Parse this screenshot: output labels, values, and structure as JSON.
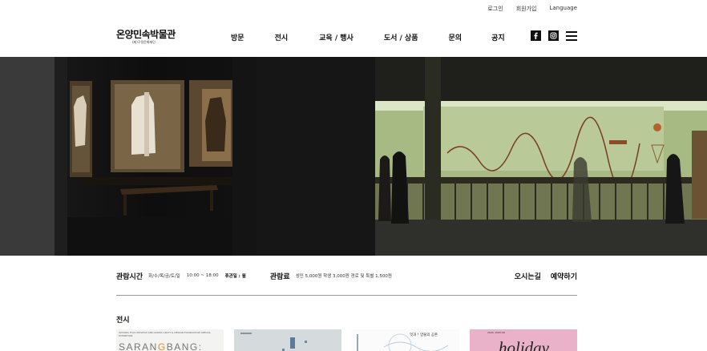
{
  "utility": {
    "login": "로그인",
    "signup": "회원가입",
    "language": "Language"
  },
  "logo": {
    "name": "온양민속박물관",
    "sub": "(재)구정문화재단"
  },
  "nav": [
    {
      "label": "방문"
    },
    {
      "label": "전시"
    },
    {
      "label": "교육 / 행사"
    },
    {
      "label": "도서 / 상품"
    },
    {
      "label": "문의"
    },
    {
      "label": "공지"
    }
  ],
  "icons": [
    "facebook-icon",
    "instagram-icon",
    "menu-icon"
  ],
  "info": {
    "hours_label": "관람시간",
    "hours_days": "화/수/목/금/토/일",
    "hours_time": "10:00 ~ 18:00",
    "closed_label": "휴관일 : 월",
    "fee_label": "관람료",
    "fee_text": "성인 5,000원 학생 3,000원 경로 및 특별 1,500원",
    "directions": "오시는길",
    "reserve": "예약하기"
  },
  "exhibitions": {
    "title": "전시",
    "items": [
      {
        "big_pre": "SARAN",
        "big_hi": "G",
        "big_post": "BANG:",
        "small": "ONYANG FOLK MUSEUM AND KOREA CRAFT & DESIGN FOUNDATION SPECIAL EXHIBITION"
      },
      {
        "caption": ""
      },
      {
        "caption": "멋과 ! 양물의 공존"
      },
      {
        "title": "holiday",
        "small": "2024. 2025.06"
      }
    ]
  }
}
